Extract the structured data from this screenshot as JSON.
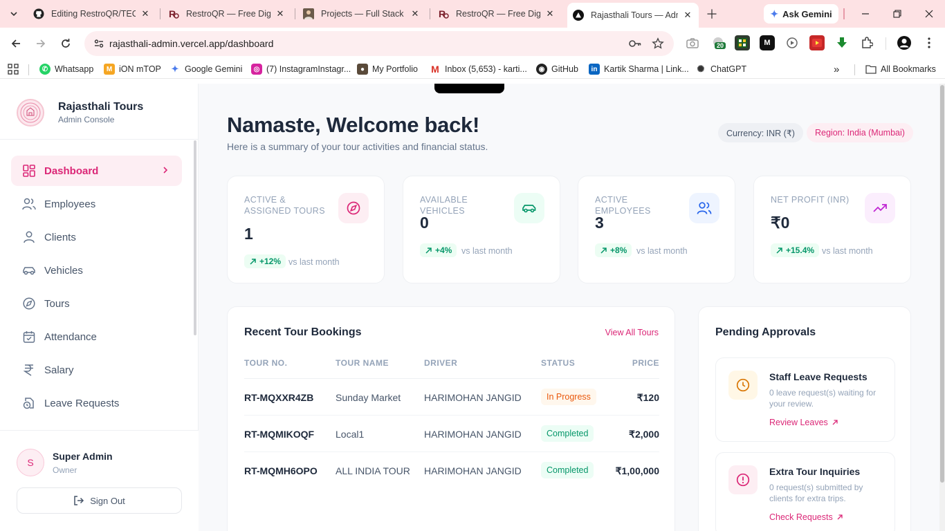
{
  "browser": {
    "tabs": [
      {
        "title": "Editing RestroQR/TECH",
        "icon": "github-icon"
      },
      {
        "title": "RestroQR — Free Digita",
        "icon": "restroqr-icon"
      },
      {
        "title": "Projects — Full Stack &",
        "icon": "portrait-icon"
      },
      {
        "title": "RestroQR — Free Digita",
        "icon": "restroqr-icon"
      },
      {
        "title": "Rajasthali Tours — Adm",
        "icon": "vercel-icon"
      }
    ],
    "ask_gemini": "Ask Gemini",
    "url": "rajasthali-admin.vercel.app/dashboard",
    "extension_badge": "20",
    "bookmarks": [
      {
        "label": "Whatsapp",
        "icon": "whatsapp-icon",
        "color": "#25d366"
      },
      {
        "label": "iON mTOP",
        "icon": "ion-icon",
        "color": "#f5a623"
      },
      {
        "label": "Google Gemini",
        "icon": "gemini-icon",
        "color": "#4b7bec"
      },
      {
        "label": "(7) InstagramInstagr...",
        "icon": "instagram-icon",
        "color": "#d6249f"
      },
      {
        "label": "My Portfolio",
        "icon": "portfolio-icon",
        "color": "#555555"
      },
      {
        "label": "Inbox (5,653) - karti...",
        "icon": "gmail-icon",
        "color": "#d93025"
      },
      {
        "label": "GitHub",
        "icon": "github-icon",
        "color": "#222222"
      },
      {
        "label": "Kartik Sharma | Link...",
        "icon": "linkedin-icon",
        "color": "#0a66c2"
      },
      {
        "label": "ChatGPT",
        "icon": "chatgpt-icon",
        "color": "#333333"
      }
    ],
    "all_bookmarks": "All Bookmarks"
  },
  "sidebar": {
    "brand_name": "Rajasthali Tours",
    "brand_sub": "Admin Console",
    "items": [
      {
        "label": "Dashboard",
        "icon": "dashboard-icon",
        "active": true
      },
      {
        "label": "Employees",
        "icon": "employees-icon",
        "active": false
      },
      {
        "label": "Clients",
        "icon": "user-icon",
        "active": false
      },
      {
        "label": "Vehicles",
        "icon": "car-icon",
        "active": false
      },
      {
        "label": "Tours",
        "icon": "compass-icon",
        "active": false
      },
      {
        "label": "Attendance",
        "icon": "calendar-check-icon",
        "active": false
      },
      {
        "label": "Salary",
        "icon": "rupee-icon",
        "active": false
      },
      {
        "label": "Leave Requests",
        "icon": "clock-file-icon",
        "active": false
      }
    ],
    "user": {
      "initial": "S",
      "name": "Super Admin",
      "role": "Owner"
    },
    "sign_out": "Sign Out"
  },
  "header": {
    "title": "Namaste, Welcome back!",
    "subtitle": "Here is a summary of your tour activities and financial status.",
    "currency": "Currency: INR (₹)",
    "region": "Region: India (Mumbai)"
  },
  "stats": [
    {
      "label": "Active & Assigned Tours",
      "value": "1",
      "trend": "+12%",
      "vs": "vs last month",
      "icon": "compass-icon",
      "accent": "#db2777",
      "bg": "#fdeef3"
    },
    {
      "label": "Available Vehicles",
      "value": "0",
      "trend": "+4%",
      "vs": "vs last month",
      "icon": "car-icon",
      "accent": "#059669",
      "bg": "#ecfdf5"
    },
    {
      "label": "Active Employees",
      "value": "3",
      "trend": "+8%",
      "vs": "vs last month",
      "icon": "users-icon",
      "accent": "#2563eb",
      "bg": "#eef4ff"
    },
    {
      "label": "Net Profit (INR)",
      "value": "₹0",
      "trend": "+15.4%",
      "vs": "vs last month",
      "icon": "trending-up-icon",
      "accent": "#c026d3",
      "bg": "#fbeefd"
    }
  ],
  "bookings": {
    "title": "Recent Tour Bookings",
    "view_all": "View All Tours",
    "columns": [
      "TOUR NO.",
      "TOUR NAME",
      "DRIVER",
      "STATUS",
      "PRICE"
    ],
    "rows": [
      {
        "tour_no": "RT-MQXXR4ZB",
        "tour_name": "Sunday Market",
        "driver": "HARIMOHAN JANGID",
        "status": "In Progress",
        "price": "₹120"
      },
      {
        "tour_no": "RT-MQMIKOQF",
        "tour_name": "Local1",
        "driver": "HARIMOHAN JANGID",
        "status": "Completed",
        "price": "₹2,000"
      },
      {
        "tour_no": "RT-MQMH6OPO",
        "tour_name": "ALL INDIA TOUR",
        "driver": "HARIMOHAN JANGID",
        "status": "Completed",
        "price": "₹1,00,000"
      }
    ]
  },
  "approvals": {
    "title": "Pending Approvals",
    "items": [
      {
        "title": "Staff Leave Requests",
        "desc": "0 leave request(s) waiting for your review.",
        "link": "Review Leaves",
        "icon": "clock-icon",
        "accent": "#d97706",
        "bg": "#fff7e6"
      },
      {
        "title": "Extra Tour Inquiries",
        "desc": "0 request(s) submitted by clients for extra trips.",
        "link": "Check Requests",
        "icon": "alert-circle-icon",
        "accent": "#db2777",
        "bg": "#fdeef3"
      }
    ]
  }
}
